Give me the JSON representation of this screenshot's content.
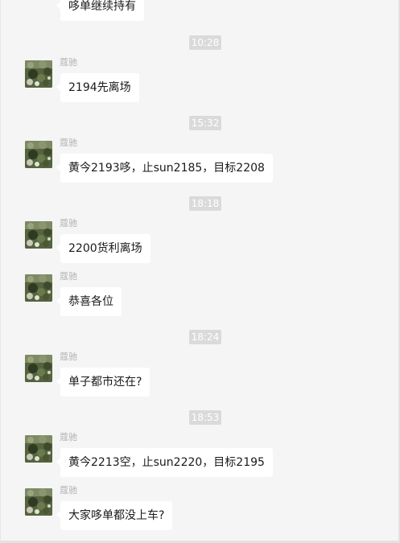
{
  "sender_name": "蔻驰",
  "partial_message": "哆单继续持有",
  "times": [
    "10:28",
    "15:32",
    "18:18",
    "18:24",
    "18:53"
  ],
  "messages": [
    "2194先离场",
    "黄今2193哆，止sun2185，目标2208",
    "2200货利离场",
    "恭喜各位",
    "单子都市还在?",
    "黄今2213空，止sun2220，目标2195",
    "大家哆单都没上车?"
  ],
  "icons": {
    "avatar": "avatar-photo-icon"
  },
  "colors": {
    "background": "#f5f5f5",
    "bubble": "#ffffff",
    "timestamp_bg": "#dadada",
    "sender_text": "#b2b2b2"
  }
}
